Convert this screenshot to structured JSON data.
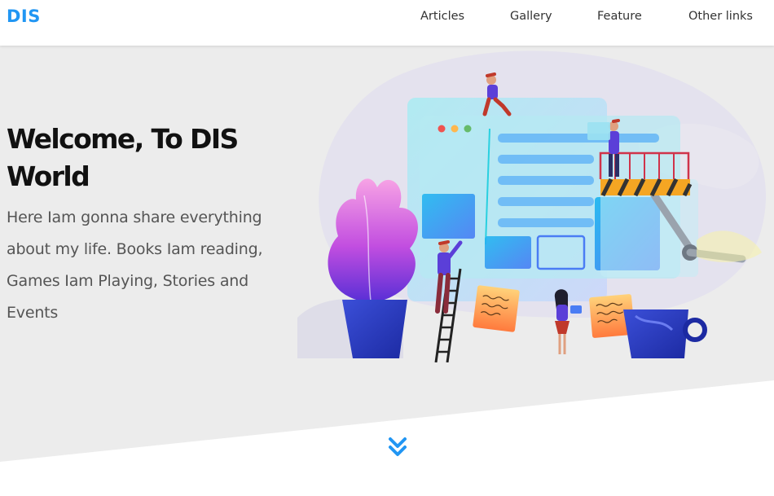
{
  "nav": {
    "logo": "DIS",
    "links": [
      "Articles",
      "Gallery",
      "Feature",
      "Other links"
    ]
  },
  "hero": {
    "title_line1": "Welcome, To DIS",
    "title_line2": "World",
    "description": "Here Iam gonna share everything about my life. Books Iam reading, Games Iam Playing, Stories and Events"
  },
  "icons": {
    "scroll": "double-chevron-down-icon",
    "illustration": "web-design-team-illustration"
  },
  "colors": {
    "brand": "#2196f3",
    "hero_bg": "#ececec",
    "title": "#111111",
    "body_text": "#555555"
  }
}
